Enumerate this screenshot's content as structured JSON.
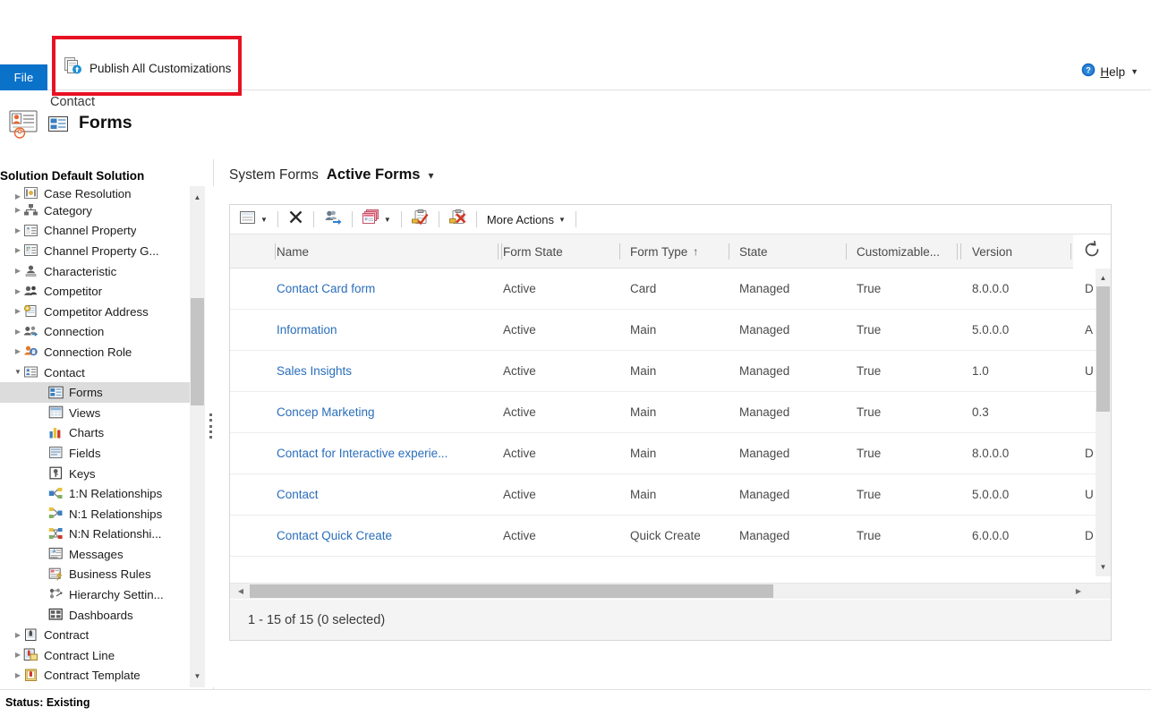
{
  "ribbon": {
    "file_tab": "File",
    "publish_button": "Publish All Customizations",
    "publish_icon": "publish-icon",
    "help_label_prefix": "H",
    "help_label_rest": "elp",
    "help_icon": "help-circle-icon",
    "highlight_color": "#e81123",
    "file_tab_color": "#0b72ca"
  },
  "entity_header": {
    "entity_name": "Contact",
    "section_title": "Forms",
    "entity_icon": "contact-card-icon",
    "section_icon": "form-icon"
  },
  "sidebar": {
    "solution_label": "Solution Default Solution",
    "items": [
      {
        "label": "Case Resolution",
        "icon": "case-resolution-icon",
        "indent": 0,
        "twisty": "collapsed",
        "selected": false,
        "clipped": true
      },
      {
        "label": "Category",
        "icon": "category-icon",
        "indent": 0,
        "twisty": "collapsed",
        "selected": false
      },
      {
        "label": "Channel Property",
        "icon": "channel-property-icon",
        "indent": 0,
        "twisty": "collapsed",
        "selected": false
      },
      {
        "label": "Channel Property G...",
        "icon": "channel-property-group-icon",
        "indent": 0,
        "twisty": "collapsed",
        "selected": false
      },
      {
        "label": "Characteristic",
        "icon": "characteristic-icon",
        "indent": 0,
        "twisty": "collapsed",
        "selected": false
      },
      {
        "label": "Competitor",
        "icon": "competitor-icon",
        "indent": 0,
        "twisty": "collapsed",
        "selected": false
      },
      {
        "label": "Competitor Address",
        "icon": "competitor-address-icon",
        "indent": 0,
        "twisty": "collapsed",
        "selected": false
      },
      {
        "label": "Connection",
        "icon": "connection-icon",
        "indent": 0,
        "twisty": "collapsed",
        "selected": false
      },
      {
        "label": "Connection Role",
        "icon": "connection-role-icon",
        "indent": 0,
        "twisty": "collapsed",
        "selected": false
      },
      {
        "label": "Contact",
        "icon": "contact-icon",
        "indent": 0,
        "twisty": "expanded",
        "selected": false
      },
      {
        "label": "Forms",
        "icon": "forms-icon",
        "indent": 1,
        "twisty": "none",
        "selected": true
      },
      {
        "label": "Views",
        "icon": "views-icon",
        "indent": 1,
        "twisty": "none",
        "selected": false
      },
      {
        "label": "Charts",
        "icon": "charts-icon",
        "indent": 1,
        "twisty": "none",
        "selected": false
      },
      {
        "label": "Fields",
        "icon": "fields-icon",
        "indent": 1,
        "twisty": "none",
        "selected": false
      },
      {
        "label": "Keys",
        "icon": "keys-icon",
        "indent": 1,
        "twisty": "none",
        "selected": false
      },
      {
        "label": "1:N Relationships",
        "icon": "one-to-many-icon",
        "indent": 1,
        "twisty": "none",
        "selected": false
      },
      {
        "label": "N:1 Relationships",
        "icon": "many-to-one-icon",
        "indent": 1,
        "twisty": "none",
        "selected": false
      },
      {
        "label": "N:N Relationshi...",
        "icon": "many-to-many-icon",
        "indent": 1,
        "twisty": "none",
        "selected": false
      },
      {
        "label": "Messages",
        "icon": "messages-icon",
        "indent": 1,
        "twisty": "none",
        "selected": false
      },
      {
        "label": "Business Rules",
        "icon": "business-rules-icon",
        "indent": 1,
        "twisty": "none",
        "selected": false
      },
      {
        "label": "Hierarchy Settin...",
        "icon": "hierarchy-settings-icon",
        "indent": 1,
        "twisty": "none",
        "selected": false
      },
      {
        "label": "Dashboards",
        "icon": "dashboards-icon",
        "indent": 1,
        "twisty": "none",
        "selected": false
      },
      {
        "label": "Contract",
        "icon": "contract-icon",
        "indent": 0,
        "twisty": "collapsed",
        "selected": false
      },
      {
        "label": "Contract Line",
        "icon": "contract-line-icon",
        "indent": 0,
        "twisty": "collapsed",
        "selected": false
      },
      {
        "label": "Contract Template",
        "icon": "contract-template-icon",
        "indent": 0,
        "twisty": "collapsed",
        "selected": false
      }
    ],
    "scroll_up_icon": "scroll-up-arrow",
    "scroll_down_icon": "scroll-down-arrow",
    "splitter": "panel-splitter"
  },
  "viewbar": {
    "system_forms": "System Forms",
    "active_view": "Active Forms",
    "caret_icon": "chevron-down-icon"
  },
  "toolbar": {
    "new_icon": "new-form-icon",
    "delete_icon": "delete-icon",
    "assign_icon": "assign-security-roles-icon",
    "copy_icon": "copy-form-icon",
    "activate_icon": "activate-icon",
    "deactivate_icon": "deactivate-icon",
    "more_actions": "More Actions",
    "more_actions_caret": "chevron-down-icon",
    "new_caret": "chevron-down-icon",
    "copy_caret": "chevron-down-icon"
  },
  "grid": {
    "columns": [
      {
        "label": "Name",
        "sorted": false
      },
      {
        "label": "Form State",
        "sorted": false
      },
      {
        "label": "Form Type",
        "sorted": true,
        "sort_dir": "↑"
      },
      {
        "label": "State",
        "sorted": false
      },
      {
        "label": "Customizable...",
        "sorted": false
      },
      {
        "label": "Version",
        "sorted": false
      }
    ],
    "refresh_icon": "refresh-icon",
    "rows": [
      {
        "name": "Contact Card form",
        "form_state": "Active",
        "form_type": "Card",
        "state": "Managed",
        "customizable": "True",
        "version": "8.0.0.0",
        "description": "D"
      },
      {
        "name": "Information",
        "form_state": "Active",
        "form_type": "Main",
        "state": "Managed",
        "customizable": "True",
        "version": "5.0.0.0",
        "description": "A"
      },
      {
        "name": "Sales Insights",
        "form_state": "Active",
        "form_type": "Main",
        "state": "Managed",
        "customizable": "True",
        "version": "1.0",
        "description": "U"
      },
      {
        "name": "Concep Marketing",
        "form_state": "Active",
        "form_type": "Main",
        "state": "Managed",
        "customizable": "True",
        "version": "0.3",
        "description": ""
      },
      {
        "name": "Contact for Interactive experie...",
        "form_state": "Active",
        "form_type": "Main",
        "state": "Managed",
        "customizable": "True",
        "version": "8.0.0.0",
        "description": "D"
      },
      {
        "name": "Contact",
        "form_state": "Active",
        "form_type": "Main",
        "state": "Managed",
        "customizable": "True",
        "version": "5.0.0.0",
        "description": "U"
      },
      {
        "name": "Contact Quick Create",
        "form_state": "Active",
        "form_type": "Quick Create",
        "state": "Managed",
        "customizable": "True",
        "version": "6.0.0.0",
        "description": "D"
      }
    ],
    "footer_count": "1 - 15 of 15 (0 selected)",
    "vscroll_up_icon": "scroll-up-arrow",
    "vscroll_down_icon": "scroll-down-arrow",
    "hscroll_left_icon": "scroll-left-arrow",
    "hscroll_right_icon": "scroll-right-arrow"
  },
  "statusbar": {
    "text": "Status: Existing"
  }
}
